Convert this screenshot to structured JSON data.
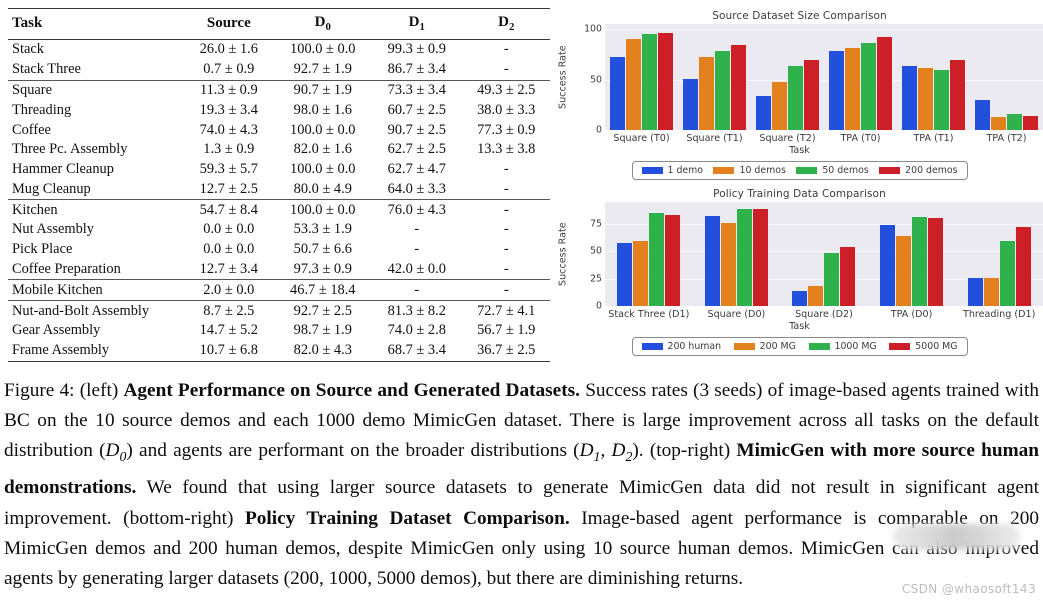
{
  "table": {
    "headers": [
      "Task",
      "Source",
      "D0",
      "D1",
      "D2"
    ],
    "groups": [
      {
        "rows": [
          {
            "task": "Stack",
            "source": "26.0 ± 1.6",
            "d0": "100.0 ± 0.0",
            "d1": "99.3 ± 0.9",
            "d2": "-"
          },
          {
            "task": "Stack Three",
            "source": "0.7 ± 0.9",
            "d0": "92.7 ± 1.9",
            "d1": "86.7 ± 3.4",
            "d2": "-"
          }
        ]
      },
      {
        "rows": [
          {
            "task": "Square",
            "source": "11.3 ± 0.9",
            "d0": "90.7 ± 1.9",
            "d1": "73.3 ± 3.4",
            "d2": "49.3 ± 2.5"
          },
          {
            "task": "Threading",
            "source": "19.3 ± 3.4",
            "d0": "98.0 ± 1.6",
            "d1": "60.7 ± 2.5",
            "d2": "38.0 ± 3.3"
          },
          {
            "task": "Coffee",
            "source": "74.0 ± 4.3",
            "d0": "100.0 ± 0.0",
            "d1": "90.7 ± 2.5",
            "d2": "77.3 ± 0.9"
          },
          {
            "task": "Three Pc. Assembly",
            "source": "1.3 ± 0.9",
            "d0": "82.0 ± 1.6",
            "d1": "62.7 ± 2.5",
            "d2": "13.3 ± 3.8"
          },
          {
            "task": "Hammer Cleanup",
            "source": "59.3 ± 5.7",
            "d0": "100.0 ± 0.0",
            "d1": "62.7 ± 4.7",
            "d2": "-"
          },
          {
            "task": "Mug Cleanup",
            "source": "12.7 ± 2.5",
            "d0": "80.0 ± 4.9",
            "d1": "64.0 ± 3.3",
            "d2": "-"
          }
        ]
      },
      {
        "rows": [
          {
            "task": "Kitchen",
            "source": "54.7 ± 8.4",
            "d0": "100.0 ± 0.0",
            "d1": "76.0 ± 4.3",
            "d2": "-"
          },
          {
            "task": "Nut Assembly",
            "source": "0.0 ± 0.0",
            "d0": "53.3 ± 1.9",
            "d1": "-",
            "d2": "-"
          },
          {
            "task": "Pick Place",
            "source": "0.0 ± 0.0",
            "d0": "50.7 ± 6.6",
            "d1": "-",
            "d2": "-"
          },
          {
            "task": "Coffee Preparation",
            "source": "12.7 ± 3.4",
            "d0": "97.3 ± 0.9",
            "d1": "42.0 ± 0.0",
            "d2": "-"
          }
        ]
      },
      {
        "rows": [
          {
            "task": "Mobile Kitchen",
            "source": "2.0 ± 0.0",
            "d0": "46.7 ± 18.4",
            "d1": "-",
            "d2": "-"
          }
        ]
      },
      {
        "rows": [
          {
            "task": "Nut-and-Bolt Assembly",
            "source": "8.7 ± 2.5",
            "d0": "92.7 ± 2.5",
            "d1": "81.3 ± 8.2",
            "d2": "72.7 ± 4.1"
          },
          {
            "task": "Gear Assembly",
            "source": "14.7 ± 5.2",
            "d0": "98.7 ± 1.9",
            "d1": "74.0 ± 2.8",
            "d2": "56.7 ± 1.9"
          },
          {
            "task": "Frame Assembly",
            "source": "10.7 ± 6.8",
            "d0": "82.0 ± 4.3",
            "d1": "68.7 ± 3.4",
            "d2": "36.7 ± 2.5"
          }
        ]
      }
    ]
  },
  "chart_data": [
    {
      "id": "source-dataset-size",
      "type": "bar",
      "title": "Source Dataset Size Comparison",
      "xlabel": "Task",
      "ylabel": "Success Rate",
      "ylim": [
        0,
        105
      ],
      "yticks": [
        0,
        50,
        100
      ],
      "grid": true,
      "legend_position": "bottom",
      "categories": [
        "Square (T0)",
        "Square (T1)",
        "Square (T2)",
        "TPA (T0)",
        "TPA (T1)",
        "TPA (T2)"
      ],
      "series": [
        {
          "name": "1 demo",
          "color": "#2250DC",
          "values": [
            72,
            51,
            34,
            78,
            63,
            30
          ]
        },
        {
          "name": "10 demos",
          "color": "#E2811E",
          "values": [
            90,
            72,
            48,
            81,
            61,
            13
          ]
        },
        {
          "name": "50 demos",
          "color": "#2FB24C",
          "values": [
            95,
            78,
            63,
            86,
            59,
            16
          ]
        },
        {
          "name": "200 demos",
          "color": "#CC1F28",
          "values": [
            96,
            84,
            69,
            92,
            69,
            14
          ]
        }
      ]
    },
    {
      "id": "policy-training-data",
      "type": "bar",
      "title": "Policy Training Data Comparison",
      "xlabel": "Task",
      "ylabel": "Success Rate",
      "ylim": [
        0,
        95
      ],
      "yticks": [
        0,
        25,
        50,
        75
      ],
      "grid": true,
      "legend_position": "bottom",
      "categories": [
        "Stack Three (D1)",
        "Square (D0)",
        "Square (D2)",
        "TPA (D0)",
        "Threading (D1)"
      ],
      "series": [
        {
          "name": "200 human",
          "color": "#2250DC",
          "values": [
            58,
            82,
            14,
            74,
            26
          ]
        },
        {
          "name": "200 MG",
          "color": "#E2811E",
          "values": [
            59,
            76,
            18,
            64,
            26
          ]
        },
        {
          "name": "1000 MG",
          "color": "#2FB24C",
          "values": [
            85,
            89,
            48,
            81,
            59
          ]
        },
        {
          "name": "5000 MG",
          "color": "#CC1F28",
          "values": [
            83,
            89,
            54,
            80,
            72
          ]
        }
      ]
    }
  ],
  "caption": {
    "figure_label": "Figure 4:",
    "seg1_plain": " (left) ",
    "seg1_bold": "Agent Performance on Source and Generated Datasets.",
    "seg2_plain": " Success rates (3 seeds) of image-based agents trained with BC on the 10 source demos and each 1000 demo MimicGen dataset. There is large improvement across all tasks on the default distribution (",
    "d0_math": "D",
    "d0_sub": "0",
    "seg3_plain": ") and agents are performant on the broader distributions (",
    "d1_math": "D",
    "d1_sub": "1",
    "comma": ", ",
    "d2_math": "D",
    "d2_sub": "2",
    "seg4_plain": "). (top-right) ",
    "seg4_bold": "MimicGen with more source human demonstrations.",
    "seg5_plain": " We found that using larger source datasets to generate MimicGen data did not result in significant agent improvement. (bottom-right) ",
    "seg5_bold": "Policy Training Dataset Comparison.",
    "seg6_plain": " Image-based agent performance is comparable on 200 MimicGen demos and 200 human demos, despite MimicGen only using 10 source human demos. MimicGen can also improved agents by generating larger datasets (200, 1000, 5000 demos), but there are diminishing returns."
  },
  "watermark": "CSDN @whaosoft143"
}
